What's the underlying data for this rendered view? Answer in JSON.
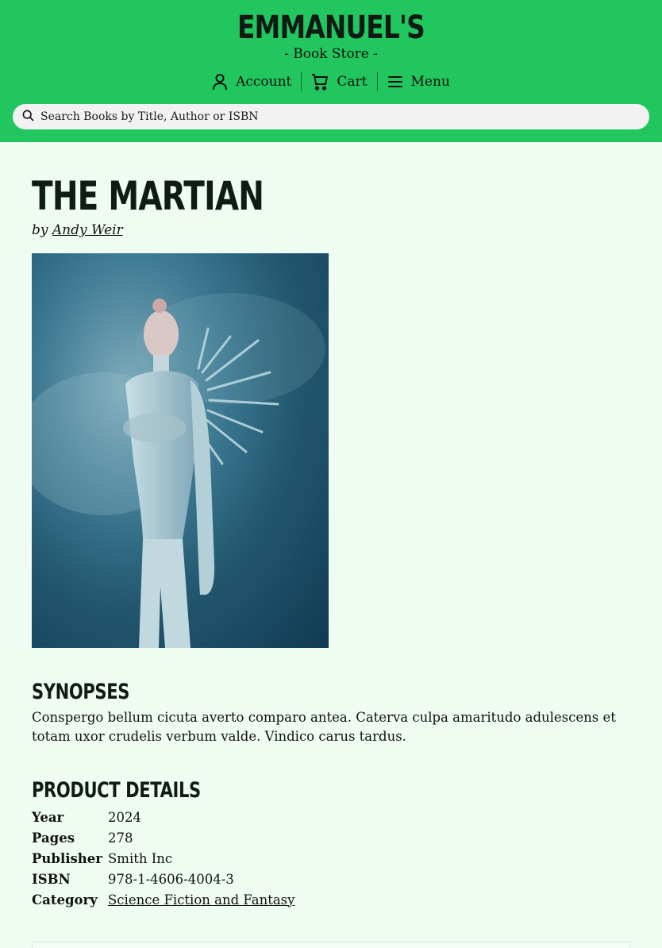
{
  "store": {
    "name": "EMMANUEL'S",
    "tagline": "- Book Store -"
  },
  "nav": {
    "account": "Account",
    "cart": "Cart",
    "menu": "Menu"
  },
  "search": {
    "placeholder": "Search Books by Title, Author or ISBN"
  },
  "book": {
    "title": "THE MARTIAN",
    "by_prefix": "by",
    "author": "Andy Weir",
    "cover_alt": "Book cover image"
  },
  "synopsis": {
    "heading": "SYNOPSES",
    "text": "Conspergo bellum cicuta averto comparo antea. Caterva culpa amaritudo adulescens et totam uxor crudelis verbum valde. Vindico carus tardus."
  },
  "details": {
    "heading": "PRODUCT DETAILS",
    "rows": [
      {
        "label": "Year",
        "value": "2024"
      },
      {
        "label": "Pages",
        "value": "278"
      },
      {
        "label": "Publisher",
        "value": "Smith Inc"
      },
      {
        "label": "ISBN",
        "value": "978-1-4606-4004-3"
      },
      {
        "label": "Category",
        "value": "Science Fiction and Fantasy"
      }
    ]
  },
  "colors": {
    "header_bg": "#22c65e",
    "page_bg": "#effcf1"
  }
}
